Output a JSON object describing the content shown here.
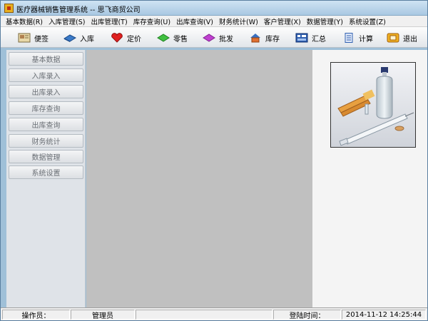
{
  "window": {
    "title": "医疗器械销售管理系统 -- 思飞商贸公司"
  },
  "menu": [
    "基本数据(R)",
    "入库管理(S)",
    "出库管理(T)",
    "库存查询(U)",
    "出库查询(V)",
    "财务统计(W)",
    "客户管理(X)",
    "数据管理(Y)",
    "系统设置(Z)"
  ],
  "toolbar": {
    "note": "便签",
    "stock_in": "入库",
    "pricing": "定价",
    "retail": "零售",
    "wholesale": "批发",
    "inventory": "库存",
    "summary": "汇总",
    "calculate": "计算",
    "exit": "退出"
  },
  "sidebar": [
    "基本数据",
    "入库录入",
    "出库录入",
    "库存查询",
    "出库查询",
    "财务统计",
    "数据管理",
    "系统设置"
  ],
  "status": {
    "operator_label": "操作员：",
    "operator_value": "管理员",
    "login_label": "登陆时间：",
    "login_value": "2014-11-12 14:25:44"
  },
  "icons": {
    "note": "notepad-icon",
    "stock_in": "book-icon",
    "pricing": "heart-icon",
    "retail": "green-gem-icon",
    "wholesale": "purple-gem-icon",
    "inventory": "house-icon",
    "summary": "calculator-icon",
    "calculate": "document-icon",
    "exit": "exit-icon"
  }
}
